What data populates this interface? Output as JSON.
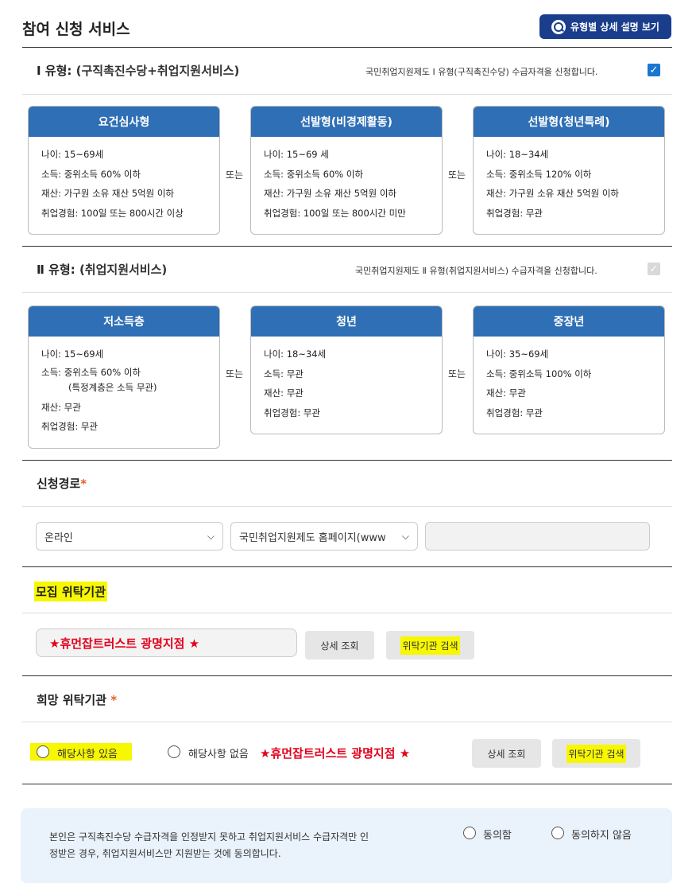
{
  "header": {
    "title": "참여 신청 서비스",
    "detail_button": "유형별 상세 설명 보기"
  },
  "type1": {
    "label": "Ⅰ 유형:",
    "sub": "(구직촉진수당+취업지원서비스)",
    "notice": "국민취업지원제도 Ⅰ 유형(구직촉진수당) 수급자격을 신청합니다.",
    "checked": true,
    "or_label": "또는",
    "cards": [
      {
        "title": "요건심사형",
        "lines": [
          "나이: 15~69세",
          "소득: 중위소득 60% 이하",
          "재산: 가구원 소유 재산 5억원 이하",
          "취업경험: 100일 또는 800시간 이상"
        ]
      },
      {
        "title": "선발형(비경제활동)",
        "lines": [
          "나이: 15~69 세",
          "소득: 중위소득 60% 이하",
          "재산: 가구원 소유 재산 5억원 이하",
          "취업경험: 100일 또는 800시간 미만"
        ]
      },
      {
        "title": "선발형(청년특례)",
        "lines": [
          "나이: 18~34세",
          "소득: 중위소득 120% 이하",
          "재산: 가구원 소유 재산 5억원 이하",
          "취업경험: 무관"
        ]
      }
    ]
  },
  "type2": {
    "label": "Ⅱ 유형:",
    "sub": "(취업지원서비스)",
    "notice": "국민취업지원제도 Ⅱ 유형(취업지원서비스) 수급자격을 신청합니다.",
    "checked": false,
    "or_label": "또는",
    "cards": [
      {
        "title": "저소득층",
        "lines": [
          "나이: 15~69세",
          "소득: 중위소득 60% 이하",
          "(특정계층은 소득 무관)",
          "재산: 무관",
          "취업경험: 무관"
        ]
      },
      {
        "title": "청년",
        "lines": [
          "나이: 18~34세",
          "소득: 무관",
          "재산: 무관",
          "취업경험: 무관"
        ]
      },
      {
        "title": "중장년",
        "lines": [
          "나이: 35~69세",
          "소득: 중위소득 100% 이하",
          "재산: 무관",
          "취업경험: 무관"
        ]
      }
    ]
  },
  "route": {
    "label": "신청경로",
    "required": "*",
    "select1": "온라인",
    "select2": "국민취업지원제도 홈페이지(www",
    "chevron": "chevron-down-icon"
  },
  "recruit": {
    "label": "모집 위탁기관",
    "org": "★휴먼잡트러스트 광명지점 ★",
    "detail_btn": "상세 조회",
    "search_btn": "위탁기관 검색",
    "highlight_color": "#f7f700"
  },
  "wish": {
    "label": "희망 위탁기관",
    "required": "*",
    "opt_yes": "해당사항 있음",
    "opt_no": "해당사항 없음",
    "org": "★휴먼잡트러스트 광명지점 ★",
    "detail_btn": "상세 조회",
    "search_btn": "위탁기관 검색"
  },
  "consent": {
    "line1": "본인은 구직촉진수당 수급자격을 인정받지 못하고 취업지원서비스 수급자격만 인",
    "line2": "정받은 경우, 취업지원서비스만 지원받는 것에 동의합니다.",
    "agree": "동의함",
    "disagree": "동의하지 않음"
  },
  "colors": {
    "card_header": "#2f6fb5",
    "detail_button": "#1a3e8c",
    "checkbox": "#1976d2",
    "red_text": "#e3001b"
  }
}
